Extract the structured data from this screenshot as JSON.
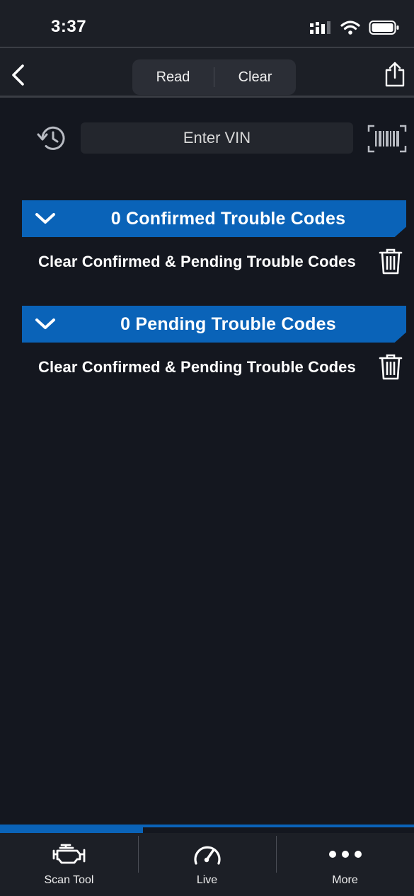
{
  "status_bar": {
    "time": "3:37"
  },
  "nav": {
    "tabs": [
      {
        "label": "Read"
      },
      {
        "label": "Clear"
      }
    ]
  },
  "vin": {
    "placeholder": "Enter VIN"
  },
  "sections": [
    {
      "title": "0 Confirmed Trouble Codes",
      "clear_label": "Clear Confirmed & Pending Trouble Codes"
    },
    {
      "title": "0 Pending Trouble Codes",
      "clear_label": "Clear Confirmed & Pending Trouble Codes"
    }
  ],
  "tab_bar": {
    "items": [
      {
        "label": "Scan Tool",
        "icon": "engine-icon"
      },
      {
        "label": "Live",
        "icon": "gauge-icon"
      },
      {
        "label": "More",
        "icon": "more-dots-icon"
      }
    ]
  },
  "colors": {
    "accent": "#0a63b8",
    "background": "#14171f",
    "bar": "#1c1f26"
  }
}
